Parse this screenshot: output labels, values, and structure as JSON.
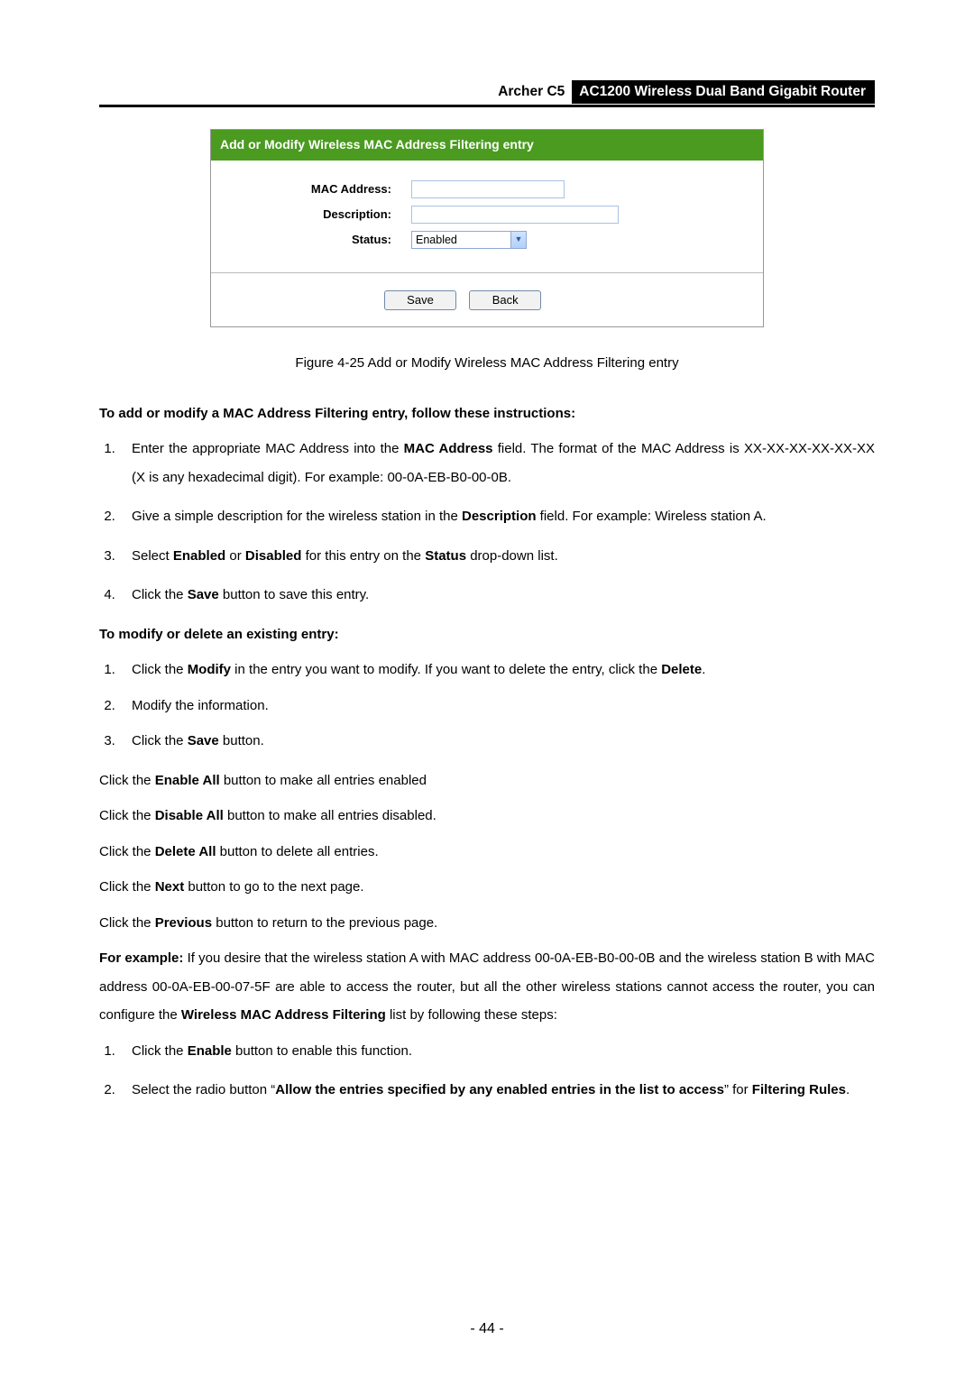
{
  "header": {
    "left": "Archer C5",
    "right": "AC1200 Wireless Dual Band Gigabit Router"
  },
  "panel": {
    "banner": "Add or Modify Wireless MAC Address Filtering entry",
    "labels": {
      "mac": "MAC Address:",
      "desc": "Description:",
      "status": "Status:"
    },
    "status_value": "Enabled",
    "buttons": {
      "save": "Save",
      "back": "Back"
    }
  },
  "caption": "Figure 4-25 Add or Modify Wireless MAC Address Filtering entry",
  "body": {
    "h1": "To add or modify a MAC Address Filtering entry, follow these instructions:",
    "add": [
      {
        "pre": "Enter  the  appropriate  MAC  Address  into  the  ",
        "b": "MAC  Address",
        "post": "  field.  The  format  of  the  MAC  Address    is    XX-XX-XX-XX-XX-XX    (X    is    any    hexadecimal    digit).    For    example: 00-0A-EB-B0-00-0B."
      },
      {
        "pre": "Give  a  simple  description  for  the  wireless  station  in  the  ",
        "b": "Description",
        "post": "  field.  For  example: Wireless station A."
      },
      {
        "pre": "Select ",
        "b": "Enabled",
        "mid": " or ",
        "b2": "Disabled",
        "post2": " for this entry on the ",
        "b3": "Status",
        "tail": " drop-down list."
      },
      {
        "pre": "Click the ",
        "b": "Save",
        "post": " button to save this entry."
      }
    ],
    "h2": "To modify or delete an existing entry:",
    "mod": [
      {
        "pre": "Click  the  ",
        "b": "Modify",
        "mid": "  in  the  entry  you  want  to  modify.  If  you  want  to  delete  the  entry,  click  the ",
        "b2": "Delete",
        "post2": "."
      },
      {
        "text": "Modify the information."
      },
      {
        "pre": "Click the ",
        "b": "Save",
        "post": " button."
      }
    ],
    "paras": [
      {
        "pre": "Click the ",
        "b": "Enable All",
        "post": " button to make all entries enabled"
      },
      {
        "pre": "Click the ",
        "b": "Disable All",
        "post": " button to make all entries disabled."
      },
      {
        "pre": "Click the ",
        "b": "Delete All",
        "post": " button to delete all entries."
      },
      {
        "pre": "Click the ",
        "b": "Next",
        "post": " button to go to the next page."
      },
      {
        "pre": "Click the ",
        "b": "Previous",
        "post": " button to return to the previous page."
      }
    ],
    "example": {
      "b1": "For example:",
      "mid": " If you desire that the wireless station A with MAC address 00-0A-EB-B0-00-0B and the wireless station B with MAC address 00-0A-EB-00-07-5F are able to access the router, but all the other wireless stations cannot access the router, you can configure the ",
      "b2": "Wireless MAC Address Filtering",
      "tail": " list by following these steps:"
    },
    "steps": [
      {
        "pre": "Click the ",
        "b": "Enable",
        "post": " button to enable this function."
      },
      {
        "pre": "Select the radio button “",
        "b": "Allow the entries specified by any enabled entries in the list to access",
        "mid": "” for ",
        "b2": "Filtering Rules",
        "post2": "."
      }
    ]
  },
  "page_no": "- 44 -"
}
